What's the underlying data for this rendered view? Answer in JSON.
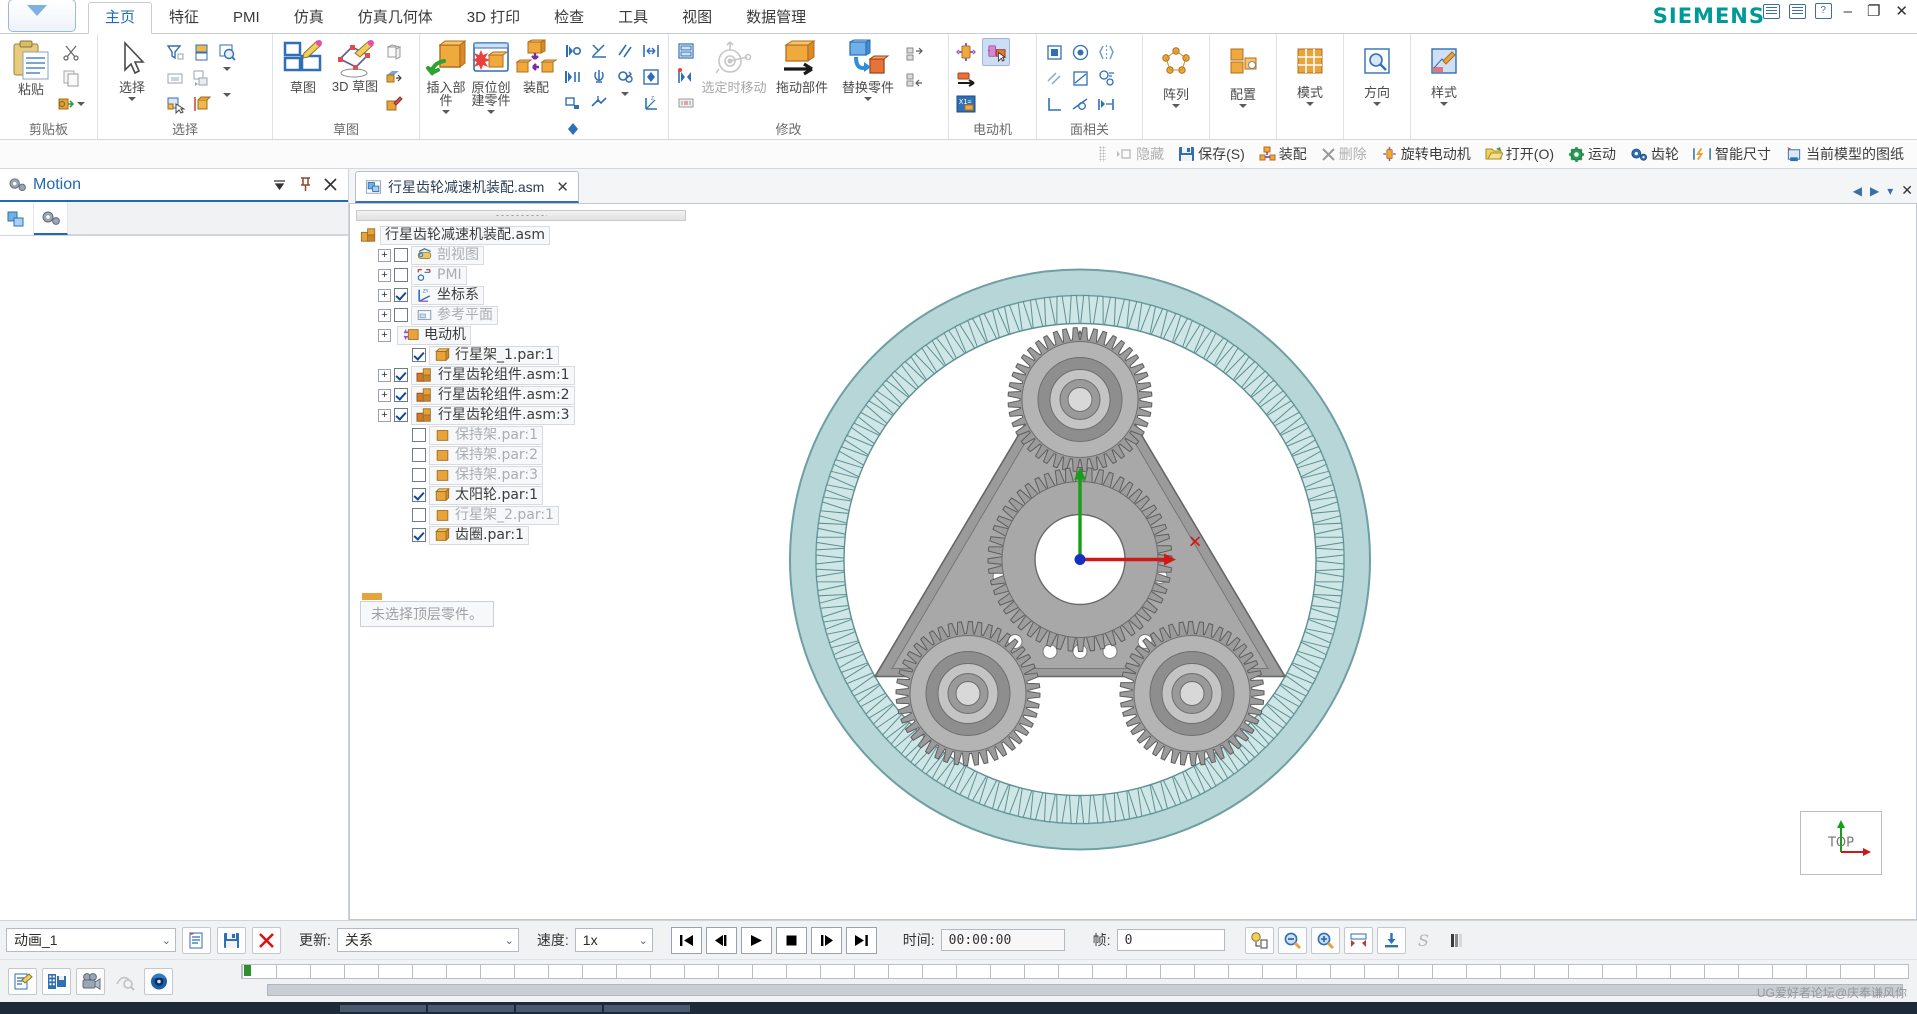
{
  "window": {
    "brand": "SIEMENS",
    "app_button": "application-menu",
    "controls": {
      "minimize": "–",
      "maximize": "❐",
      "close": "✕",
      "help": "?"
    }
  },
  "ribbon_tabs": [
    {
      "label": "主页",
      "active": true
    },
    {
      "label": "特征",
      "active": false
    },
    {
      "label": "PMI",
      "active": false
    },
    {
      "label": "仿真",
      "active": false
    },
    {
      "label": "仿真几何体",
      "active": false
    },
    {
      "label": "3D 打印",
      "active": false
    },
    {
      "label": "检查",
      "active": false
    },
    {
      "label": "工具",
      "active": false
    },
    {
      "label": "视图",
      "active": false
    },
    {
      "label": "数据管理",
      "active": false
    }
  ],
  "ribbon_groups": [
    {
      "name": "剪贴板",
      "big": [
        {
          "label": "粘贴",
          "icon": "paste-icon",
          "caret": true
        }
      ],
      "small": [
        "cut-icon",
        "copy-icon",
        "paste-special-icon"
      ]
    },
    {
      "name": "选择",
      "big": [
        {
          "label": "选择",
          "icon": "select-arrow-icon",
          "caret": true
        }
      ],
      "small": [
        "select-filter-icon",
        "select-stack-icon",
        "find-icon",
        "select-window-icon",
        "select-list-icon",
        "select-similar-icon",
        "select-face-icon",
        "select-edge-icon"
      ]
    },
    {
      "name": "草图",
      "big": [
        {
          "label": "草图",
          "icon": "sketch-icon",
          "caret": false
        },
        {
          "label": "3D 草图",
          "icon": "sketch3d-icon",
          "caret": false
        }
      ],
      "small": [
        "copy-sketch-icon",
        "project-icon",
        "edit-sketch-icon"
      ]
    },
    {
      "name": "装配",
      "big": [
        {
          "label": "插入部件",
          "icon": "insert-part-icon",
          "caret": true
        },
        {
          "label": "原位创建零件",
          "icon": "create-in-place-icon",
          "caret": true
        },
        {
          "label": "装配",
          "icon": "assemble-icon",
          "caret": false
        }
      ],
      "small": [
        "mate-icon",
        "angle-icon",
        "parallel-icon",
        "flush-icon",
        "axial-align-icon",
        "insert-icon",
        "gear-relation-icon",
        "center-plane-icon",
        "ground-icon",
        "connect-icon",
        "more-icon",
        "coord-relation-icon",
        "tangent-icon"
      ]
    },
    {
      "name": "修改",
      "big": [
        {
          "label": "选定时移动",
          "icon": "move-on-select-icon",
          "dim": true
        },
        {
          "label": "拖动部件",
          "icon": "drag-component-icon",
          "dim": false
        },
        {
          "label": "替换零件",
          "icon": "replace-part-icon",
          "caret": true
        }
      ],
      "small": [
        "mirror-components-icon",
        "pattern-copy-icon",
        "disperse-icon",
        "align-left-icon",
        "align-right-icon"
      ]
    },
    {
      "name": "电动机",
      "small": [
        "rotary-motor-icon",
        "linear-motor-icon",
        "motor-variables-icon"
      ],
      "highlighted": [
        "drag-motor-icon"
      ]
    },
    {
      "name": "面相关",
      "small": [
        "planar-face-icon",
        "cylindrical-face-icon",
        "mirror-face-icon",
        "parallel-face-icon",
        "angled-face-icon",
        "concentric-face-icon",
        "perpendicular-face-icon",
        "tangent-face-icon",
        "align-face-icon"
      ]
    },
    {
      "name": "阵列",
      "big": [
        {
          "label": "阵列",
          "icon": "pattern-icon",
          "caret": true
        }
      ]
    },
    {
      "name": "配置",
      "big": [
        {
          "label": "配置",
          "icon": "configuration-icon",
          "caret": true
        }
      ]
    },
    {
      "name": "模式",
      "big": [
        {
          "label": "模式",
          "icon": "pattern-grid-icon",
          "caret": true
        }
      ]
    },
    {
      "name": "方向",
      "big": [
        {
          "label": "方向",
          "icon": "orientation-icon",
          "caret": true
        }
      ]
    },
    {
      "name": "样式",
      "big": [
        {
          "label": "样式",
          "icon": "style-icon",
          "caret": true
        }
      ]
    }
  ],
  "quickbar": [
    {
      "label": "隐藏",
      "icon": "hide-icon",
      "dim": true
    },
    {
      "label": "保存(S)",
      "icon": "save-icon",
      "dim": false
    },
    {
      "label": "装配",
      "icon": "assemble-icon",
      "dim": false
    },
    {
      "label": "删除",
      "icon": "delete-icon",
      "dim": true
    },
    {
      "label": "旋转电动机",
      "icon": "rotary-motor-icon",
      "dim": false
    },
    {
      "label": "打开(O)",
      "icon": "open-icon",
      "dim": false
    },
    {
      "label": "运动",
      "icon": "motion-icon",
      "dim": false
    },
    {
      "label": "齿轮",
      "icon": "gear-icon",
      "dim": false
    },
    {
      "label": "智能尺寸",
      "icon": "smart-dimension-icon",
      "dim": false
    },
    {
      "label": "当前模型的图纸",
      "icon": "drawing-icon",
      "dim": false
    }
  ],
  "left_panel": {
    "title": "Motion",
    "tabs": [
      "assembly-pathfinder-tab",
      "motion-tab"
    ],
    "controls": [
      "dropdown-icon",
      "pin-icon",
      "close-icon"
    ]
  },
  "document_tab": {
    "label": "行星齿轮减速机装配.asm",
    "icon": "assembly-doc-icon",
    "close": "✕"
  },
  "tree": {
    "root": {
      "label": "行星齿轮减速机装配.asm",
      "icon": "assembly-icon"
    },
    "items": [
      {
        "label": "剖视图",
        "icon": "section-view-icon",
        "expand": true,
        "checked": false,
        "dim": true,
        "indent": 1
      },
      {
        "label": "PMI",
        "icon": "pmi-icon",
        "expand": true,
        "checked": false,
        "dim": true,
        "indent": 1
      },
      {
        "label": "坐标系",
        "icon": "coordinate-system-icon",
        "expand": true,
        "checked": true,
        "dim": false,
        "indent": 1
      },
      {
        "label": "参考平面",
        "icon": "reference-plane-icon",
        "expand": true,
        "checked": false,
        "dim": true,
        "indent": 1
      },
      {
        "label": "电动机",
        "icon": "motor-icon",
        "expand": true,
        "checked": null,
        "dim": false,
        "indent": 1
      },
      {
        "label": "行星架_1.par:1",
        "icon": "part-icon",
        "expand": false,
        "checked": true,
        "dim": false,
        "indent": 2
      },
      {
        "label": "行星齿轮组件.asm:1",
        "icon": "subassembly-icon",
        "expand": true,
        "checked": true,
        "dim": false,
        "indent": 1
      },
      {
        "label": "行星齿轮组件.asm:2",
        "icon": "subassembly-icon",
        "expand": true,
        "checked": true,
        "dim": false,
        "indent": 1
      },
      {
        "label": "行星齿轮组件.asm:3",
        "icon": "subassembly-icon",
        "expand": true,
        "checked": true,
        "dim": false,
        "indent": 1
      },
      {
        "label": "保持架.par:1",
        "icon": "part-plain-icon",
        "expand": false,
        "checked": false,
        "dim": true,
        "indent": 2
      },
      {
        "label": "保持架.par:2",
        "icon": "part-plain-icon",
        "expand": false,
        "checked": false,
        "dim": true,
        "indent": 2
      },
      {
        "label": "保持架.par:3",
        "icon": "part-plain-icon",
        "expand": false,
        "checked": false,
        "dim": true,
        "indent": 2
      },
      {
        "label": "太阳轮.par:1",
        "icon": "part-icon",
        "expand": false,
        "checked": true,
        "dim": false,
        "indent": 2
      },
      {
        "label": "行星架_2.par:1",
        "icon": "part-plain-icon",
        "expand": false,
        "checked": false,
        "dim": true,
        "indent": 2
      },
      {
        "label": "齿圈.par:1",
        "icon": "part-icon",
        "expand": false,
        "checked": true,
        "dim": false,
        "indent": 2
      }
    ],
    "status_message": "未选择顶层零件。"
  },
  "viewcube": {
    "label": "TOP"
  },
  "animation_bar": {
    "animation_name": "动画_1",
    "buttons": [
      "new-animation-icon",
      "save-animation-icon",
      "delete-animation-icon"
    ],
    "update_label": "更新:",
    "update_value": "关系",
    "speed_label": "速度:",
    "speed_value": "1x",
    "transport": [
      "skip-start-icon",
      "step-back-icon",
      "play-icon",
      "stop-icon",
      "step-forward-icon",
      "skip-end-icon"
    ],
    "time_label": "时间:",
    "time_value": "00:00:00",
    "frame_label": "帧:",
    "frame_value": "0",
    "right_buttons": [
      "key-frame-icon",
      "zoom-out-icon",
      "zoom-in-icon",
      "fit-icon",
      "export-icon",
      "s-curve-icon",
      "gradient-icon"
    ]
  },
  "timeline_buttons": [
    "edit-definition-icon",
    "save-movie-icon",
    "camera-icon",
    "motion-path-icon",
    "render-icon"
  ],
  "watermark": "UG爱好者论坛@庆奉谦风你"
}
